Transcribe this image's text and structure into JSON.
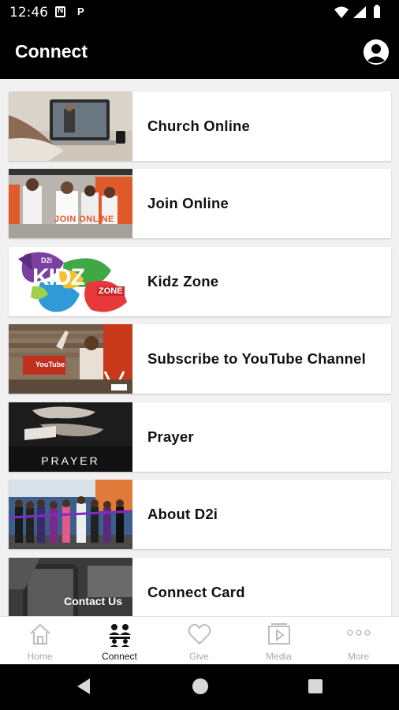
{
  "status_bar": {
    "time": "12:46",
    "notif_p": "P"
  },
  "header": {
    "title": "Connect"
  },
  "list": [
    {
      "label": "Church Online",
      "thumb": "church-online-thumbnail"
    },
    {
      "label": "Join Online",
      "thumb": "join-online-thumbnail",
      "thumb_text": "JOIN ONLINE"
    },
    {
      "label": "Kidz Zone",
      "thumb": "kidz-zone-thumbnail",
      "thumb_text": "KIDZ",
      "thumb_sub": "ZONE",
      "thumb_badge": "D2i"
    },
    {
      "label": "Subscribe to YouTube Channel",
      "thumb": "youtube-thumbnail",
      "thumb_text": "YouTube"
    },
    {
      "label": "Prayer",
      "thumb": "prayer-thumbnail",
      "thumb_text": "PRAYER"
    },
    {
      "label": "About D2i",
      "thumb": "about-thumbnail"
    },
    {
      "label": "Connect Card",
      "thumb": "connect-card-thumbnail",
      "thumb_text": "Contact Us"
    }
  ],
  "bottom_nav": [
    {
      "label": "Home",
      "icon": "home-icon",
      "active": false
    },
    {
      "label": "Connect",
      "icon": "connect-icon",
      "active": true
    },
    {
      "label": "Give",
      "icon": "heart-icon",
      "active": false
    },
    {
      "label": "Media",
      "icon": "media-icon",
      "active": false
    },
    {
      "label": "More",
      "icon": "more-icon",
      "active": false
    }
  ],
  "colors": {
    "header_bg": "#000000",
    "content_bg": "#f1f1f1",
    "nav_inactive": "#a9a9a9",
    "nav_active": "#111111"
  }
}
